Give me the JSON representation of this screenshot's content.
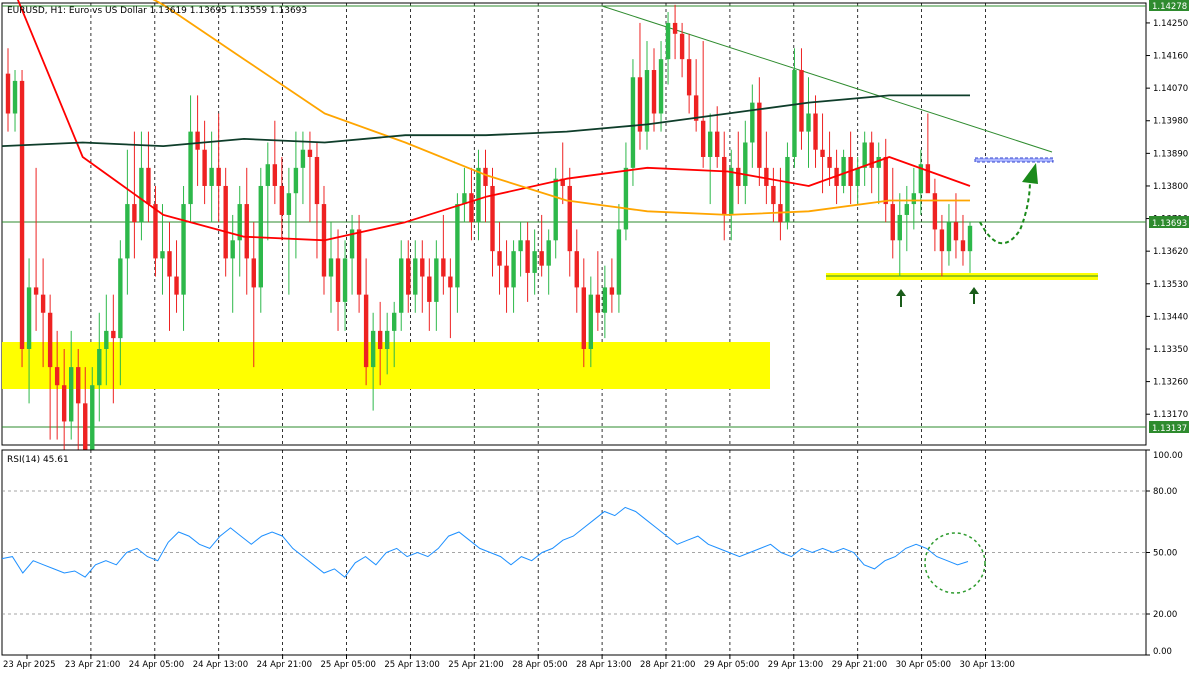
{
  "chart_data": [
    {
      "type": "candlestick",
      "title": "EURUSD, H1:  Euro vs US Dollar  1.13619 1.13695 1.13559 1.13693",
      "ylim": [
        1.13085,
        1.14305
      ],
      "y_ticks": [
        "1.14250",
        "1.14160",
        "1.14070",
        "1.13980",
        "1.13890",
        "1.13800",
        "1.13710",
        "1.13620",
        "1.13530",
        "1.13440",
        "1.13350",
        "1.13260",
        "1.13170"
      ],
      "price_labels": {
        "high": "1.14278",
        "current": "1.13693",
        "low": "1.13137"
      },
      "x_ticks": [
        "23 Apr 2025",
        "23 Apr 21:00",
        "24 Apr 05:00",
        "24 Apr 13:00",
        "24 Apr 21:00",
        "25 Apr 05:00",
        "25 Apr 13:00",
        "25 Apr 21:00",
        "28 Apr 05:00",
        "28 Apr 13:00",
        "28 Apr 21:00",
        "29 Apr 05:00",
        "29 Apr 13:00",
        "29 Apr 21:00",
        "30 Apr 05:00",
        "30 Apr 13:00"
      ],
      "candles_ohlc": [
        [
          1.1411,
          1.1418,
          1.1395,
          1.14
        ],
        [
          1.14,
          1.1412,
          1.1395,
          1.1409
        ],
        [
          1.1409,
          1.1412,
          1.133,
          1.1335
        ],
        [
          1.1335,
          1.136,
          1.132,
          1.1352
        ],
        [
          1.1352,
          1.1385,
          1.134,
          1.135
        ],
        [
          1.135,
          1.136,
          1.133,
          1.1345
        ],
        [
          1.1345,
          1.135,
          1.131,
          1.133
        ],
        [
          1.133,
          1.134,
          1.131,
          1.1325
        ],
        [
          1.1325,
          1.1335,
          1.13,
          1.1315
        ],
        [
          1.1315,
          1.134,
          1.131,
          1.133
        ],
        [
          1.133,
          1.1335,
          1.1305,
          1.132
        ],
        [
          1.132,
          1.133,
          1.1295,
          1.13
        ],
        [
          1.13,
          1.133,
          1.1295,
          1.1325
        ],
        [
          1.1325,
          1.1345,
          1.1315,
          1.1335
        ],
        [
          1.1335,
          1.135,
          1.1325,
          1.134
        ],
        [
          1.134,
          1.135,
          1.132,
          1.1338
        ],
        [
          1.1338,
          1.1365,
          1.1325,
          1.136
        ],
        [
          1.136,
          1.139,
          1.135,
          1.1375
        ],
        [
          1.1375,
          1.1395,
          1.136,
          1.137
        ],
        [
          1.137,
          1.1395,
          1.1365,
          1.1385
        ],
        [
          1.1385,
          1.1395,
          1.137,
          1.1375
        ],
        [
          1.1375,
          1.138,
          1.1355,
          1.136
        ],
        [
          1.136,
          1.1375,
          1.135,
          1.1362
        ],
        [
          1.1362,
          1.137,
          1.134,
          1.1355
        ],
        [
          1.1355,
          1.1365,
          1.1345,
          1.135
        ],
        [
          1.135,
          1.138,
          1.134,
          1.1375
        ],
        [
          1.1375,
          1.1405,
          1.137,
          1.1395
        ],
        [
          1.1395,
          1.1405,
          1.138,
          1.139
        ],
        [
          1.139,
          1.1398,
          1.1375,
          1.138
        ],
        [
          1.138,
          1.1395,
          1.137,
          1.1385
        ],
        [
          1.1385,
          1.14,
          1.137,
          1.138
        ],
        [
          1.138,
          1.1385,
          1.1355,
          1.136
        ],
        [
          1.136,
          1.1372,
          1.1345,
          1.1365
        ],
        [
          1.1365,
          1.138,
          1.1355,
          1.1375
        ],
        [
          1.1375,
          1.1385,
          1.135,
          1.136
        ],
        [
          1.136,
          1.137,
          1.133,
          1.1352
        ],
        [
          1.1352,
          1.1385,
          1.1345,
          1.138
        ],
        [
          1.138,
          1.1392,
          1.1365,
          1.1386
        ],
        [
          1.1386,
          1.1398,
          1.1375,
          1.138
        ],
        [
          1.138,
          1.1388,
          1.1365,
          1.1372
        ],
        [
          1.1372,
          1.1385,
          1.135,
          1.1378
        ],
        [
          1.1378,
          1.1395,
          1.136,
          1.1385
        ],
        [
          1.1385,
          1.1395,
          1.1375,
          1.139
        ],
        [
          1.139,
          1.1395,
          1.137,
          1.1388
        ],
        [
          1.1388,
          1.1392,
          1.136,
          1.1375
        ],
        [
          1.1375,
          1.138,
          1.135,
          1.1355
        ],
        [
          1.1355,
          1.137,
          1.1345,
          1.136
        ],
        [
          1.136,
          1.1368,
          1.134,
          1.1348
        ],
        [
          1.1348,
          1.1365,
          1.134,
          1.136
        ],
        [
          1.136,
          1.1372,
          1.135,
          1.1368
        ],
        [
          1.1368,
          1.1372,
          1.1345,
          1.135
        ],
        [
          1.135,
          1.136,
          1.1325,
          1.133
        ],
        [
          1.133,
          1.1345,
          1.1318,
          1.134
        ],
        [
          1.134,
          1.1348,
          1.1325,
          1.1335
        ],
        [
          1.1335,
          1.1345,
          1.1328,
          1.134
        ],
        [
          1.134,
          1.1348,
          1.133,
          1.1345
        ],
        [
          1.1345,
          1.1365,
          1.134,
          1.136
        ],
        [
          1.136,
          1.1365,
          1.1345,
          1.135
        ],
        [
          1.135,
          1.1365,
          1.1345,
          1.136
        ],
        [
          1.136,
          1.1365,
          1.1345,
          1.1355
        ],
        [
          1.1355,
          1.136,
          1.134,
          1.1348
        ],
        [
          1.1348,
          1.1365,
          1.134,
          1.136
        ],
        [
          1.136,
          1.1372,
          1.135,
          1.1355
        ],
        [
          1.1355,
          1.136,
          1.1338,
          1.1352
        ],
        [
          1.1352,
          1.1378,
          1.1345,
          1.1375
        ],
        [
          1.1375,
          1.1385,
          1.137,
          1.1378
        ],
        [
          1.1378,
          1.1385,
          1.1365,
          1.137
        ],
        [
          1.137,
          1.139,
          1.1365,
          1.1385
        ],
        [
          1.1385,
          1.139,
          1.137,
          1.138
        ],
        [
          1.138,
          1.1385,
          1.1355,
          1.1362
        ],
        [
          1.1362,
          1.137,
          1.135,
          1.1358
        ],
        [
          1.1358,
          1.1365,
          1.1345,
          1.1352
        ],
        [
          1.1352,
          1.1365,
          1.1345,
          1.1362
        ],
        [
          1.1362,
          1.137,
          1.1355,
          1.1365
        ],
        [
          1.1365,
          1.137,
          1.1348,
          1.1356
        ],
        [
          1.1356,
          1.1368,
          1.135,
          1.1362
        ],
        [
          1.1362,
          1.1372,
          1.1355,
          1.1358
        ],
        [
          1.1358,
          1.1368,
          1.135,
          1.1365
        ],
        [
          1.1365,
          1.1385,
          1.136,
          1.1382
        ],
        [
          1.1382,
          1.1392,
          1.1375,
          1.138
        ],
        [
          1.138,
          1.1385,
          1.1355,
          1.1362
        ],
        [
          1.1362,
          1.1368,
          1.1345,
          1.1352
        ],
        [
          1.1352,
          1.136,
          1.133,
          1.1335
        ],
        [
          1.1335,
          1.1355,
          1.133,
          1.135
        ],
        [
          1.135,
          1.1362,
          1.134,
          1.1345
        ],
        [
          1.1345,
          1.1358,
          1.1338,
          1.1352
        ],
        [
          1.1352,
          1.136,
          1.1345,
          1.135
        ],
        [
          1.135,
          1.1375,
          1.1345,
          1.1368
        ],
        [
          1.1368,
          1.1392,
          1.1365,
          1.1385
        ],
        [
          1.1385,
          1.1415,
          1.138,
          1.141
        ],
        [
          1.141,
          1.1425,
          1.139,
          1.1395
        ],
        [
          1.1395,
          1.142,
          1.139,
          1.1412
        ],
        [
          1.1412,
          1.1418,
          1.1395,
          1.14
        ],
        [
          1.14,
          1.142,
          1.1395,
          1.1415
        ],
        [
          1.1415,
          1.1428,
          1.1408,
          1.1425
        ],
        [
          1.1425,
          1.143,
          1.1415,
          1.1422
        ],
        [
          1.1422,
          1.1425,
          1.141,
          1.1415
        ],
        [
          1.1415,
          1.1422,
          1.14,
          1.1405
        ],
        [
          1.1405,
          1.1415,
          1.1395,
          1.1398
        ],
        [
          1.1398,
          1.142,
          1.1385,
          1.1388
        ],
        [
          1.1388,
          1.14,
          1.1375,
          1.1395
        ],
        [
          1.1395,
          1.1402,
          1.1385,
          1.1388
        ],
        [
          1.1388,
          1.1395,
          1.1365,
          1.1372
        ],
        [
          1.1372,
          1.139,
          1.1365,
          1.1385
        ],
        [
          1.1385,
          1.1395,
          1.1375,
          1.138
        ],
        [
          1.138,
          1.1398,
          1.1375,
          1.1392
        ],
        [
          1.1392,
          1.1408,
          1.1385,
          1.1403
        ],
        [
          1.1403,
          1.141,
          1.138,
          1.1385
        ],
        [
          1.1385,
          1.1395,
          1.1375,
          1.138
        ],
        [
          1.138,
          1.1385,
          1.137,
          1.1375
        ],
        [
          1.1375,
          1.1385,
          1.1365,
          1.137
        ],
        [
          1.137,
          1.1392,
          1.1368,
          1.1388
        ],
        [
          1.1388,
          1.1418,
          1.1385,
          1.1412
        ],
        [
          1.1412,
          1.1418,
          1.139,
          1.1395
        ],
        [
          1.1395,
          1.141,
          1.1385,
          1.14
        ],
        [
          1.14,
          1.1405,
          1.1385,
          1.139
        ],
        [
          1.139,
          1.14,
          1.1378,
          1.1388
        ],
        [
          1.1388,
          1.1395,
          1.138,
          1.1385
        ],
        [
          1.1385,
          1.139,
          1.1375,
          1.138
        ],
        [
          1.138,
          1.139,
          1.1378,
          1.1388
        ],
        [
          1.1388,
          1.1395,
          1.1375,
          1.138
        ],
        [
          1.138,
          1.1388,
          1.1375,
          1.1385
        ],
        [
          1.1385,
          1.1395,
          1.138,
          1.1392
        ],
        [
          1.1392,
          1.1395,
          1.1378,
          1.1385
        ],
        [
          1.1385,
          1.1392,
          1.1375,
          1.1388
        ],
        [
          1.1388,
          1.1393,
          1.137,
          1.1375
        ],
        [
          1.1375,
          1.1385,
          1.136,
          1.1365
        ],
        [
          1.1365,
          1.1378,
          1.1355,
          1.1372
        ],
        [
          1.1372,
          1.138,
          1.1362,
          1.1375
        ],
        [
          1.1375,
          1.1385,
          1.1368,
          1.1378
        ],
        [
          1.1378,
          1.139,
          1.1372,
          1.1386
        ],
        [
          1.1386,
          1.14,
          1.138,
          1.1378
        ],
        [
          1.1378,
          1.1382,
          1.1362,
          1.1368
        ],
        [
          1.1368,
          1.1372,
          1.1355,
          1.1362
        ],
        [
          1.1362,
          1.1375,
          1.1358,
          1.137
        ],
        [
          1.137,
          1.1378,
          1.136,
          1.1365
        ],
        [
          1.1365,
          1.1372,
          1.1358,
          1.1362
        ],
        [
          1.1362,
          1.137,
          1.1356,
          1.1369
        ]
      ],
      "series": [
        {
          "name": "",
          "color": "#ff0000",
          "kind": "moving-average",
          "values": [
            1.1442,
            1.1388,
            1.1372,
            1.1366,
            1.1365,
            1.137,
            1.1377,
            1.1382,
            1.1385,
            1.1384,
            1.138,
            1.1388,
            1.138
          ]
        },
        {
          "name": "",
          "color": "#ffa500",
          "kind": "moving-average",
          "values": [
            1.1448,
            1.1442,
            1.143,
            1.1415,
            1.14,
            1.1392,
            1.1383,
            1.1376,
            1.1373,
            1.1372,
            1.1373,
            1.1376,
            1.1376
          ]
        },
        {
          "name": "",
          "color": "#0e3d2a",
          "kind": "moving-average",
          "values": [
            1.1391,
            1.1392,
            1.1391,
            1.1393,
            1.1392,
            1.1394,
            1.1394,
            1.1395,
            1.1397,
            1.14,
            1.1403,
            1.1405,
            1.1405
          ]
        }
      ]
    },
    {
      "type": "line",
      "title": "RSI(14) 45.61",
      "ylim": [
        0,
        100
      ],
      "y_ticks": [
        "100.00",
        "80.00",
        "50.00",
        "20.00",
        "0.00"
      ],
      "series": [
        {
          "name": "",
          "color": "#1e90ff",
          "values": [
            47,
            48,
            40,
            46,
            44,
            42,
            40,
            41,
            38,
            44,
            46,
            44,
            50,
            52,
            48,
            46,
            55,
            60,
            58,
            54,
            52,
            58,
            62,
            58,
            54,
            58,
            60,
            58,
            52,
            48,
            44,
            40,
            42,
            38,
            45,
            48,
            44,
            50,
            52,
            48,
            50,
            48,
            52,
            58,
            60,
            56,
            52,
            50,
            48,
            44,
            48,
            46,
            50,
            52,
            56,
            58,
            62,
            66,
            70,
            68,
            72,
            70,
            66,
            62,
            58,
            54,
            56,
            58,
            54,
            52,
            50,
            48,
            50,
            52,
            54,
            50,
            48,
            52,
            50,
            52,
            50,
            52,
            50,
            44,
            42,
            46,
            48,
            52,
            54,
            52,
            48,
            46,
            44,
            45.61
          ]
        }
      ]
    }
  ]
}
